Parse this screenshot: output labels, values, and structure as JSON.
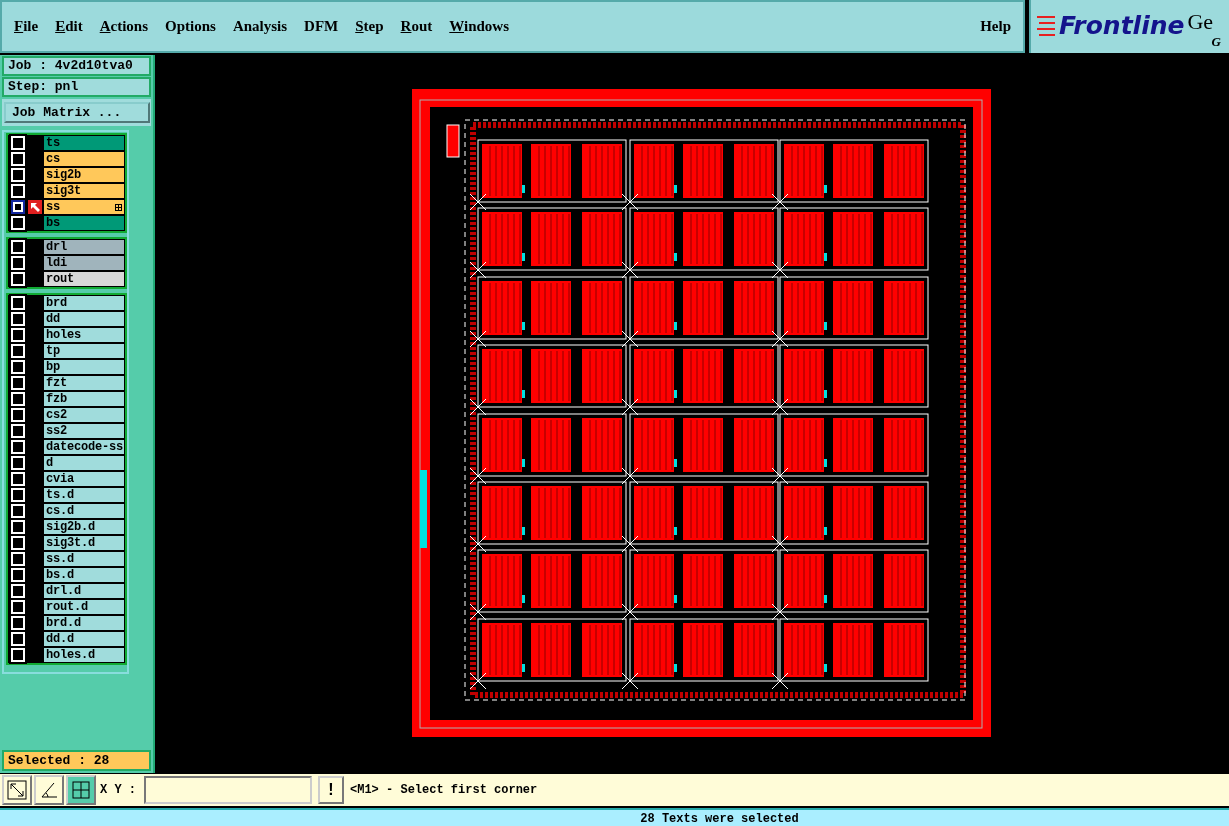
{
  "menu": [
    {
      "label": "File",
      "mnemonic": true
    },
    {
      "label": "Edit",
      "mnemonic": true
    },
    {
      "label": "Actions",
      "mnemonic": true
    },
    {
      "label": "Options",
      "mnemonic": false
    },
    {
      "label": "Analysis",
      "mnemonic": false
    },
    {
      "label": "DFM",
      "mnemonic": false
    },
    {
      "label": "Step",
      "mnemonic": true
    },
    {
      "label": "Rout",
      "mnemonic": true
    },
    {
      "label": "Windows",
      "mnemonic": true
    }
  ],
  "help": "Help",
  "logo": {
    "name": "Frontline",
    "title_cut": "Ge",
    "subtitle_cut": "G"
  },
  "job": "Job : 4v2d10tva0",
  "step": "Step: pnl",
  "job_matrix_button": "Job Matrix ...",
  "layer_groups": [
    {
      "layers": [
        {
          "name": "ts",
          "color": "#009977",
          "selected": false
        },
        {
          "name": "cs",
          "color": "#ffc85a",
          "selected": false
        },
        {
          "name": "sig2b",
          "color": "#ffc85a",
          "selected": false
        },
        {
          "name": "sig3t",
          "color": "#ffc85a",
          "selected": false
        },
        {
          "name": "ss",
          "color": "#ffc85a",
          "selected": true
        },
        {
          "name": "bs",
          "color": "#009977",
          "selected": false
        }
      ]
    },
    {
      "layers": [
        {
          "name": "drl",
          "color": "#a0b4bc",
          "selected": false
        },
        {
          "name": "ldi",
          "color": "#a0b4bc",
          "selected": false
        },
        {
          "name": "rout",
          "color": "#d8d8d8",
          "selected": false
        }
      ]
    },
    {
      "layers": [
        {
          "name": "brd",
          "color": "#a0dcdc",
          "selected": false
        },
        {
          "name": "dd",
          "color": "#a0dcdc",
          "selected": false
        },
        {
          "name": "holes",
          "color": "#a0dcdc",
          "selected": false
        },
        {
          "name": "tp",
          "color": "#a0dcdc",
          "selected": false
        },
        {
          "name": "bp",
          "color": "#a0dcdc",
          "selected": false
        },
        {
          "name": "fzt",
          "color": "#a0dcdc",
          "selected": false
        },
        {
          "name": "fzb",
          "color": "#a0dcdc",
          "selected": false
        },
        {
          "name": "cs2",
          "color": "#a0dcdc",
          "selected": false
        },
        {
          "name": "ss2",
          "color": "#a0dcdc",
          "selected": false
        },
        {
          "name": "datecode-ss",
          "color": "#a0dcdc",
          "selected": false
        },
        {
          "name": "d",
          "color": "#a0dcdc",
          "selected": false
        },
        {
          "name": "cvia",
          "color": "#a0dcdc",
          "selected": false
        },
        {
          "name": "ts.d",
          "color": "#a0dcdc",
          "selected": false
        },
        {
          "name": "cs.d",
          "color": "#a0dcdc",
          "selected": false
        },
        {
          "name": "sig2b.d",
          "color": "#a0dcdc",
          "selected": false
        },
        {
          "name": "sig3t.d",
          "color": "#a0dcdc",
          "selected": false
        },
        {
          "name": "ss.d",
          "color": "#a0dcdc",
          "selected": false
        },
        {
          "name": "bs.d",
          "color": "#a0dcdc",
          "selected": false
        },
        {
          "name": "drl.d",
          "color": "#a0dcdc",
          "selected": false
        },
        {
          "name": "rout.d",
          "color": "#a0dcdc",
          "selected": false
        },
        {
          "name": "brd.d",
          "color": "#a0dcdc",
          "selected": false
        },
        {
          "name": "dd.d",
          "color": "#a0dcdc",
          "selected": false
        },
        {
          "name": "holes.d",
          "color": "#a0dcdc",
          "selected": false
        }
      ]
    }
  ],
  "selected_count": "Selected : 28",
  "xy_label": "X Y :",
  "alert_button": "!",
  "prompt": "<M1> - Select first corner",
  "status": "28 Texts were selected"
}
